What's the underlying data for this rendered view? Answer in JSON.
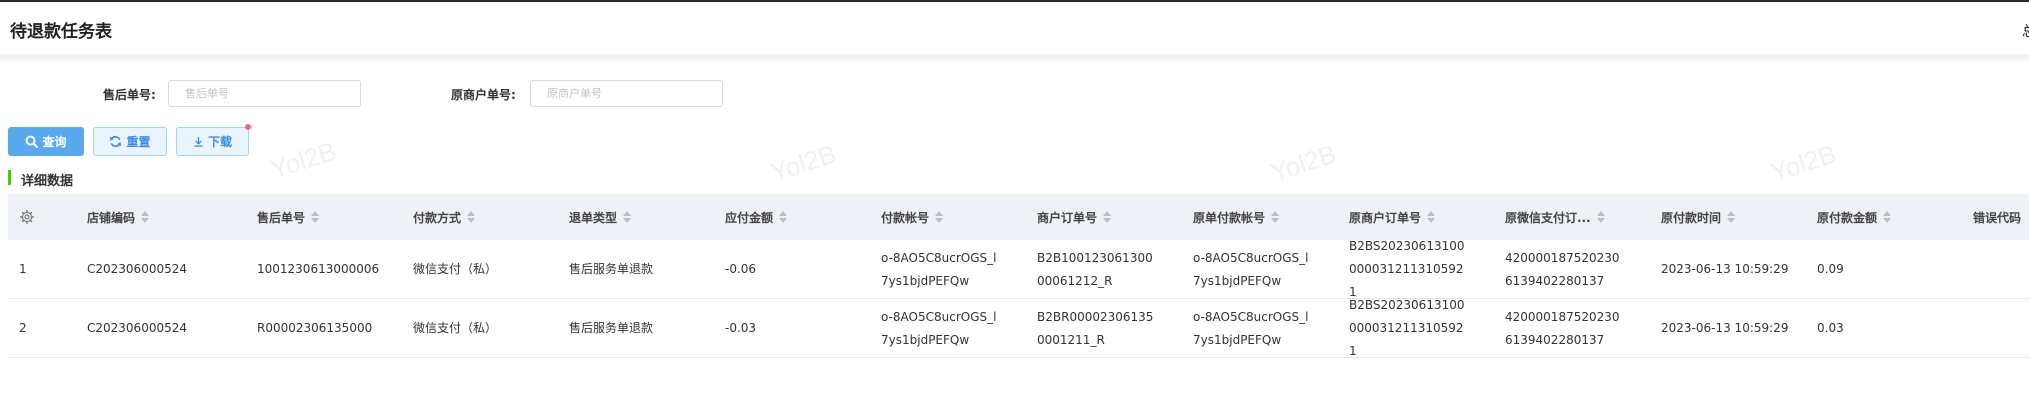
{
  "page": {
    "title": "待退款任务表",
    "header_right": "总"
  },
  "filters": [
    {
      "label": "售后单号:",
      "placeholder": "售后单号",
      "value": ""
    },
    {
      "label": "原商户单号:",
      "placeholder": "原商户单号",
      "value": ""
    }
  ],
  "toolbar": {
    "query_label": "查询",
    "reset_label": "重置",
    "download_label": "下载"
  },
  "section": {
    "title": "详细数据"
  },
  "watermark": "Yol2B",
  "table": {
    "columns": [
      "店铺编码",
      "售后单号",
      "付款方式",
      "退单类型",
      "应付金额",
      "付款帐号",
      "商户订单号",
      "原单付款帐号",
      "原商户订单号",
      "原微信支付订...",
      "原付款时间",
      "原付款金额",
      "错误代码"
    ],
    "rows": [
      [
        "1",
        "C202306000524",
        "1001230613000006",
        "微信支付（私）",
        "售后服务单退款",
        "-0.06",
        "o-8AO5C8ucrOGS_l7ys1bjdPEFQw",
        "B2B10012306130000061212_R",
        "o-8AO5C8ucrOGS_l7ys1bjdPEFQw",
        "B2BS202306131000000312113105921",
        "420000187520230613940228013​7",
        "2023-06-13 10:59:29",
        "0.09",
        ""
      ],
      [
        "2",
        "C202306000524",
        "R00002306135000",
        "微信支付（私）",
        "售后服务单退款",
        "-0.03",
        "o-8AO5C8ucrOGS_l7ys1bjdPEFQw",
        "B2BR000023061350001211_R",
        "o-8AO5C8ucrOGS_l7ys1bjdPEFQw",
        "B2BS202306131000000312113105921",
        "420000187520230613940228013​7",
        "2023-06-13 10:59:29",
        "0.03",
        ""
      ]
    ]
  },
  "colors": {
    "primary": "#58a9ef",
    "section_bar": "#52c41a",
    "header_bg": "#eef1f6",
    "badge": "#f56c6c"
  },
  "icons": {
    "query": "search-icon",
    "reset": "refresh-icon",
    "download": "download-icon",
    "settings": "gear-icon"
  }
}
